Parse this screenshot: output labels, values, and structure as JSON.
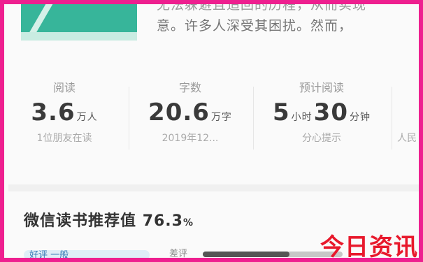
{
  "book": {
    "description_line1": "无法躲避且追回的历程，从而实现",
    "description_line2": "意。许多人深受其困扰。然而，"
  },
  "stats": [
    {
      "label": "阅读",
      "value": "3.6",
      "unit": "万人",
      "sub": "1位朋友在读"
    },
    {
      "label": "字数",
      "value": "20.6",
      "unit": "万字",
      "sub": "2019年12..."
    },
    {
      "label": "预计阅读",
      "value_a": "5",
      "unit_a": "小时",
      "value_b": "30",
      "unit_b": "分钟",
      "sub": "分心提示"
    },
    {
      "label": "",
      "value": "",
      "unit": "",
      "sub": "人民"
    }
  ],
  "recommend": {
    "label": "微信读书推荐值",
    "value": "76.3",
    "suffix": "%"
  },
  "bottom": {
    "chip_text": "好评  一般",
    "mini_label": "差评",
    "progress": 0.62
  },
  "watermark": "今日资讯",
  "colors": {
    "border": "#ee1f8f",
    "cover": "#37b59a",
    "watermark": "#e8192c"
  }
}
